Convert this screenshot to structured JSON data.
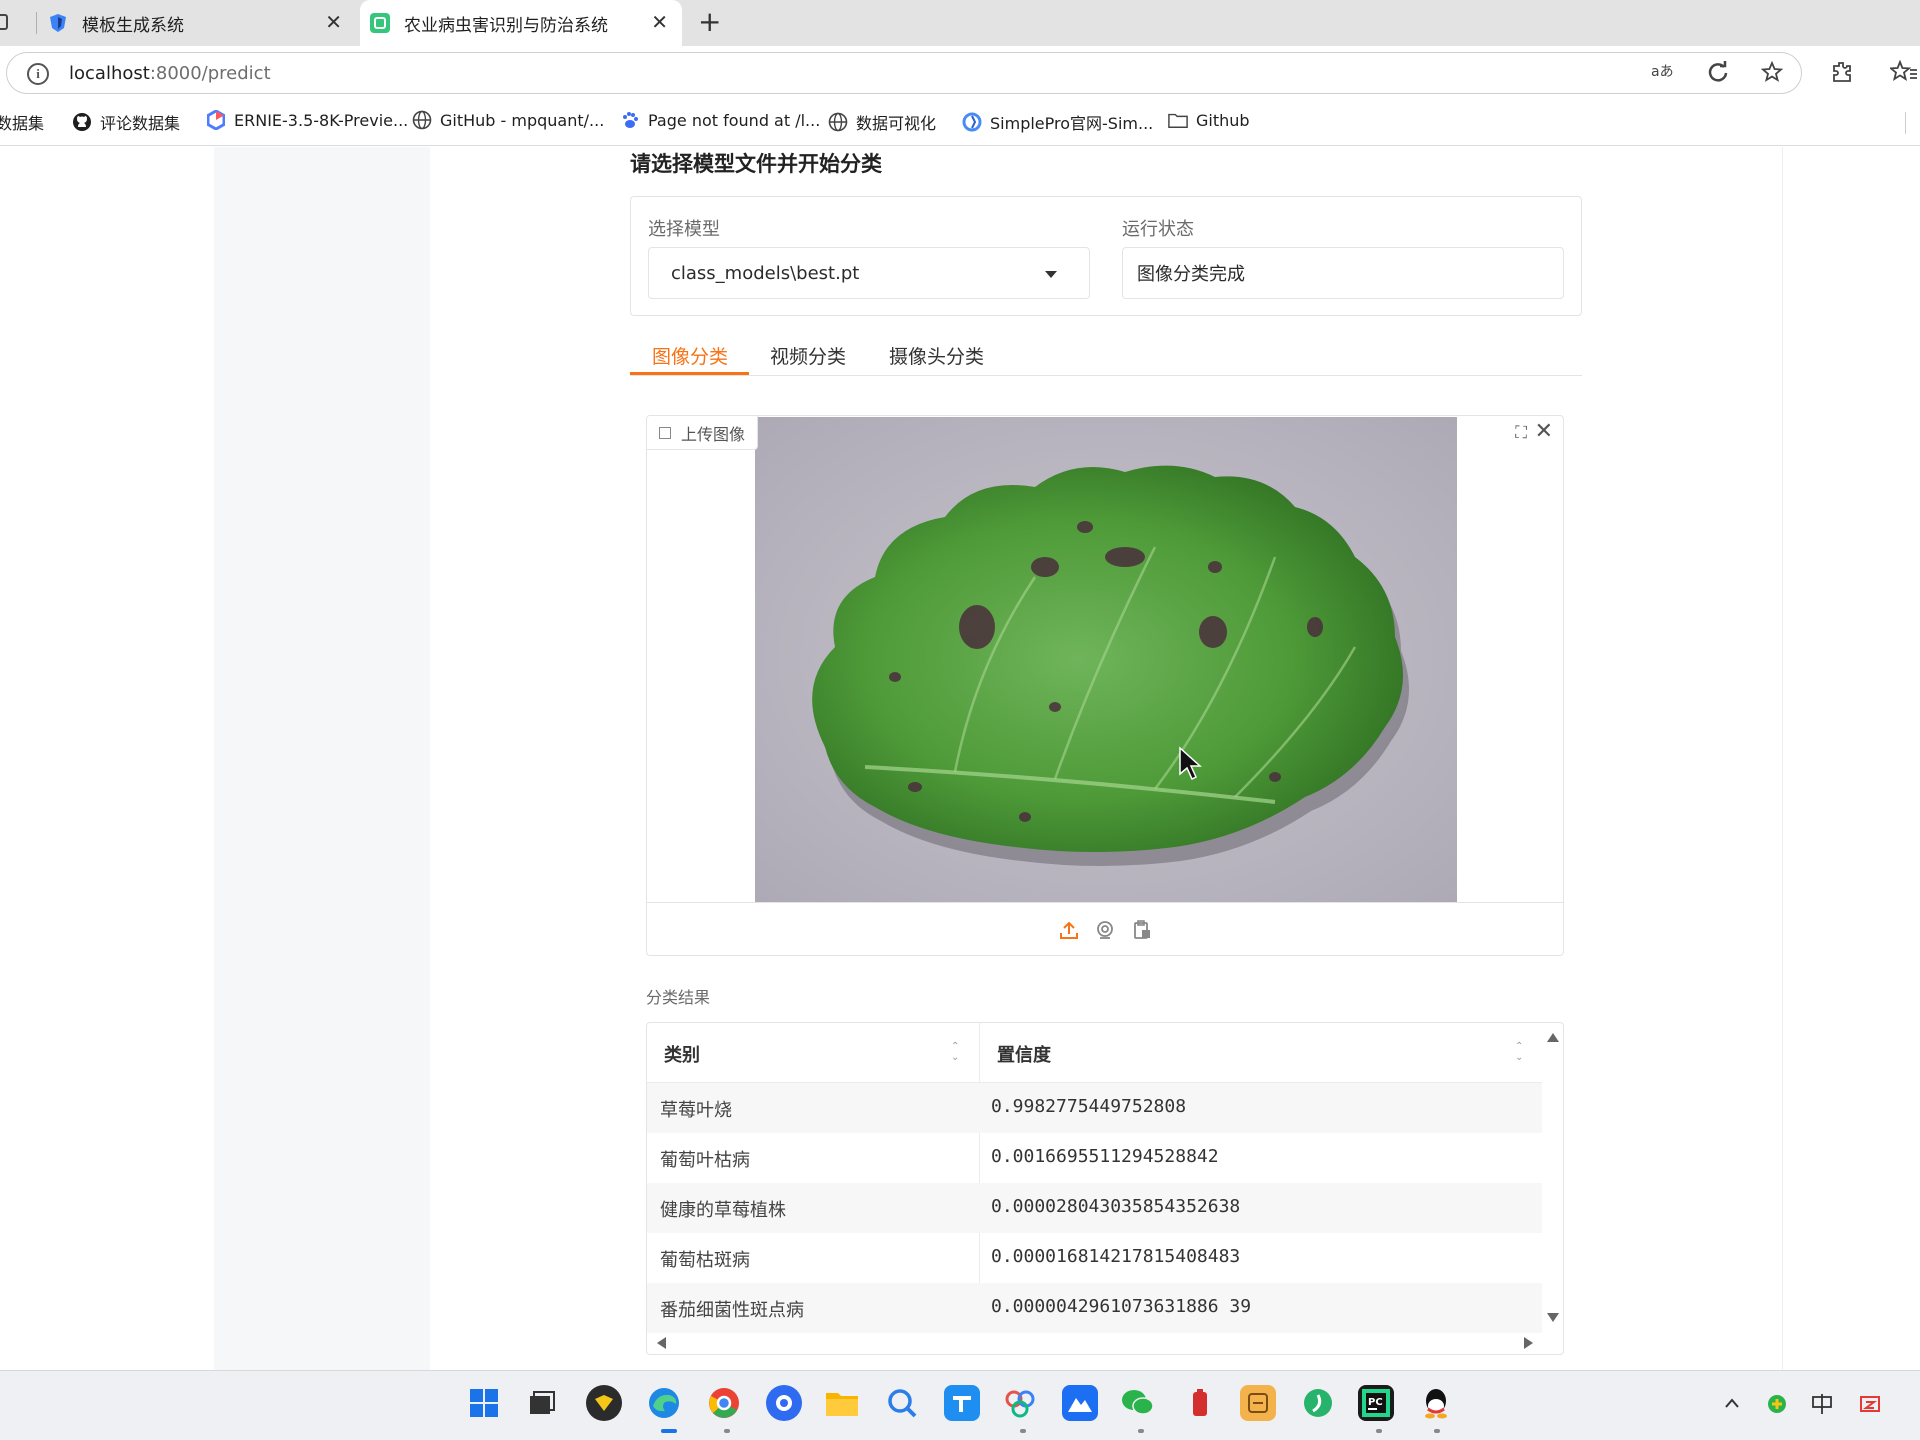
{
  "browser": {
    "tabs": [
      {
        "title": "模板生成系统",
        "icon": "vue-shield-icon",
        "active": false
      },
      {
        "title": "农业病虫害识别与防治系统",
        "icon": "app-logo-icon",
        "active": true
      }
    ],
    "address": {
      "host": "localhost",
      "rest": ":8000/predict"
    },
    "bookmarks": [
      {
        "label": "数据集",
        "icon": "partial"
      },
      {
        "label": "评论数据集",
        "icon": "github-icon"
      },
      {
        "label": "ERNIE-3.5-8K-Previe...",
        "icon": "ernie-icon"
      },
      {
        "label": "GitHub - mpquant/...",
        "icon": "globe-icon"
      },
      {
        "label": "Page not found at /l...",
        "icon": "paw-icon"
      },
      {
        "label": "数据可视化",
        "icon": "globe-icon"
      },
      {
        "label": "SimplePro官网-Sim...",
        "icon": "simplepro-icon"
      },
      {
        "label": "Github",
        "icon": "folder-icon"
      }
    ]
  },
  "page": {
    "section_title": "请选择模型文件并开始分类",
    "model_label": "选择模型",
    "model_value": "class_models\\best.pt",
    "status_label": "运行状态",
    "status_value": "图像分类完成",
    "tabs": [
      {
        "label": "图像分类",
        "active": true
      },
      {
        "label": "视频分类",
        "active": false
      },
      {
        "label": "摄像头分类",
        "active": false
      }
    ],
    "upload_label": "上传图像",
    "result_label": "分类结果",
    "table": {
      "headers": [
        "类别",
        "置信度"
      ],
      "rows": [
        {
          "category": "草莓叶烧",
          "confidence": "0.9982775449752808"
        },
        {
          "category": "葡萄叶枯病",
          "confidence": "0.0016695511294528842"
        },
        {
          "category": "健康的草莓植株",
          "confidence": "0.000028043035854352638"
        },
        {
          "category": "葡萄枯斑病",
          "confidence": "0.000016814217815408483"
        },
        {
          "category": "番茄细菌性斑点病",
          "confidence": "0.0000042961073631886 39"
        }
      ]
    }
  },
  "colors": {
    "accent": "#f97316",
    "leaf": "#4f9a3a",
    "backdrop": "#b9b7c2"
  }
}
